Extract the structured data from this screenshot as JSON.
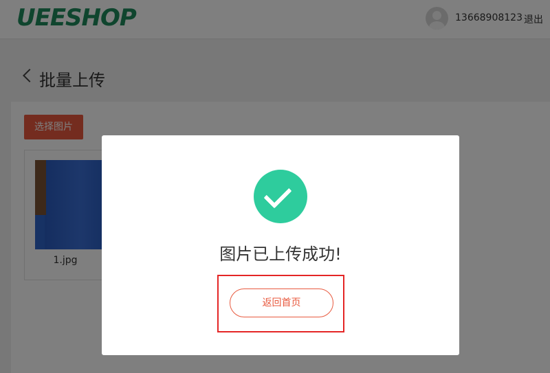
{
  "header": {
    "logo_text": "UEESHOP",
    "user_phone": "13668908123",
    "logout_label": "退出"
  },
  "page": {
    "title": "批量上传",
    "select_button_label": "选择图片",
    "uploaded_files": [
      {
        "name": "1.jpg"
      }
    ]
  },
  "modal": {
    "message": "图片已上传成功!",
    "home_button_label": "返回首页"
  },
  "colors": {
    "brand": "#1f8a5c",
    "accent": "#e8593e",
    "success": "#2ecc9d",
    "highlight_border": "#e42525"
  }
}
